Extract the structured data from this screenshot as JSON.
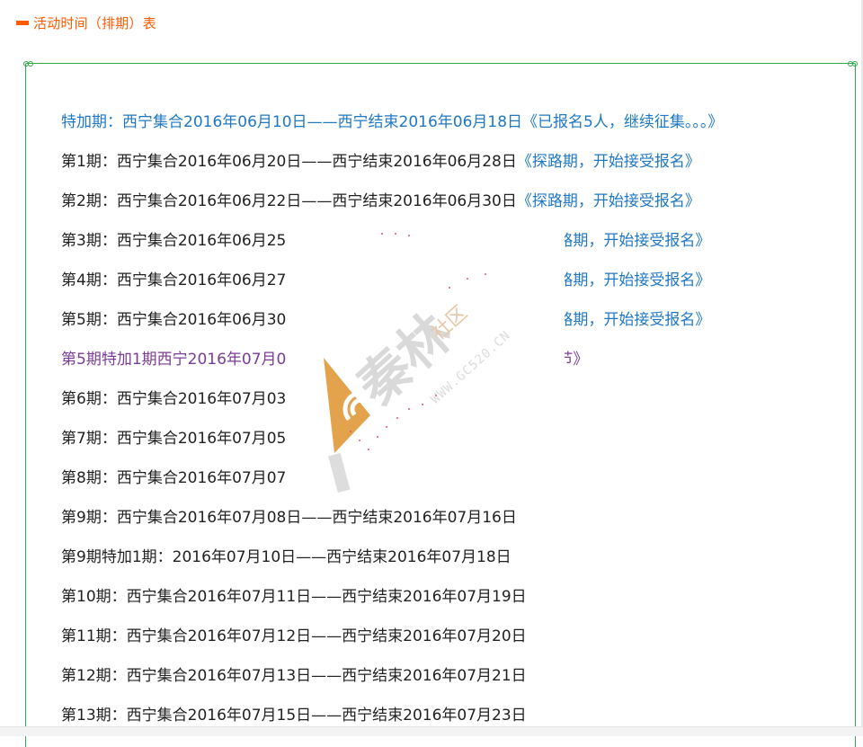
{
  "header": {
    "title": "活动时间（排期）表"
  },
  "colors": {
    "accent": "#ff5a00",
    "frame": "#2ea84a",
    "link": "#2078c3",
    "purple": "#7b3c96",
    "watermark": "#e3a24c"
  },
  "schedule": {
    "rows": [
      {
        "text": "特加期：西宁集合2016年06月10日——西宁结束2016年06月18日《已报名5人，继续征集。。。》",
        "note": ""
      },
      {
        "text": "第1期：西宁集合2016年06月20日——西宁结束2016年06月28日",
        "note": "《探路期，开始接受报名》"
      },
      {
        "text": "第2期：西宁集合2016年06月22日——西宁结束2016年06月30日",
        "note": "《探路期，开始接受报名》"
      },
      {
        "text": "第3期：西宁集合2016年06月25",
        "note": "路期，开始接受报名》"
      },
      {
        "text": "第4期：西宁集合2016年06月27",
        "note": "路期，开始接受报名》"
      },
      {
        "text": "第5期：西宁集合2016年06月30",
        "note": "路期，开始接受报名》"
      },
      {
        "text": "第5期特加1期西宁2016年07月0",
        "note": "节》"
      },
      {
        "text": "第6期：西宁集合2016年07月03",
        "note": ""
      },
      {
        "text": "第7期：西宁集合2016年07月05",
        "note": ""
      },
      {
        "text": "第8期：西宁集合2016年07月07",
        "note": ""
      },
      {
        "text": "第9期：西宁集合2016年07月08日——西宁结束2016年07月16日",
        "note": ""
      },
      {
        "text": "第9期特加1期：2016年07月10日——西宁结束2016年07月18日",
        "note": ""
      },
      {
        "text": "第10期：西宁集合2016年07月11日——西宁结束2016年07月19日",
        "note": ""
      },
      {
        "text": "第11期：西宁集合2016年07月12日——西宁结束2016年07月20日",
        "note": ""
      },
      {
        "text": "第12期：西宁集合2016年07月13日——西宁结束2016年07月21日",
        "note": ""
      },
      {
        "text": "第13期：西宁集合2016年07月15日——西宁结束2016年07月23日",
        "note": ""
      }
    ]
  },
  "watermark": {
    "text_cn": "秦林",
    "community": "社区",
    "url": "WWW.GC520.CN"
  }
}
